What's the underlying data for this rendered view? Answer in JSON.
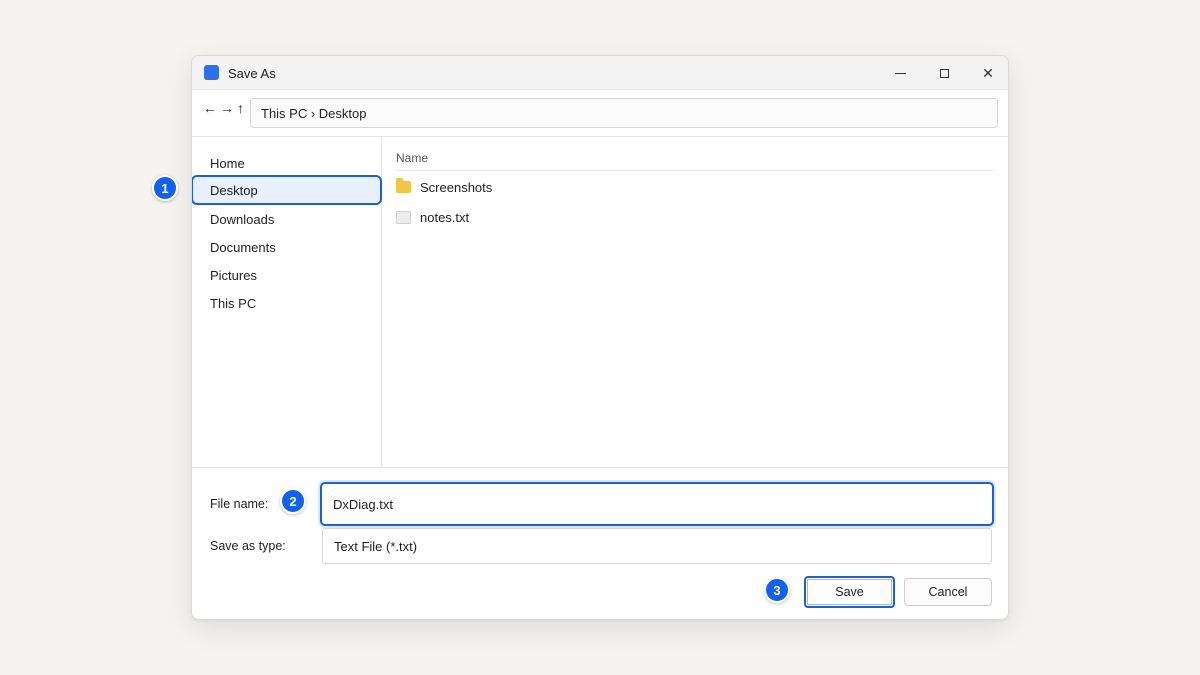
{
  "window": {
    "title": "Save As",
    "controls": {
      "minimize": "minimize-icon",
      "maximize": "maximize-icon",
      "close": "✕"
    }
  },
  "nav": {
    "back": "←",
    "forward": "→",
    "up": "↑",
    "address": "This PC › Desktop"
  },
  "sidebar": {
    "items": [
      {
        "label": "Home"
      },
      {
        "label": "Desktop",
        "selected": true
      },
      {
        "label": "Downloads"
      },
      {
        "label": "Documents"
      },
      {
        "label": "Pictures"
      },
      {
        "label": "This PC"
      }
    ]
  },
  "filelist": {
    "column_name": "Name",
    "files": [
      {
        "name": "Screenshots",
        "icon": "folder-icon"
      },
      {
        "name": "notes.txt",
        "icon": "text-file-icon"
      }
    ]
  },
  "form": {
    "filename_label": "File name:",
    "filename_value": "DxDiag.txt",
    "type_label": "Save as type:",
    "type_value": "Text File (*.txt)"
  },
  "buttons": {
    "save": "Save",
    "cancel": "Cancel"
  },
  "steps": [
    "1",
    "2",
    "3"
  ],
  "colors": {
    "accent": "#1f5fd6",
    "badge": "#1261ea",
    "selected_bg": "#e8f0fd",
    "folder": "#f2c644"
  }
}
